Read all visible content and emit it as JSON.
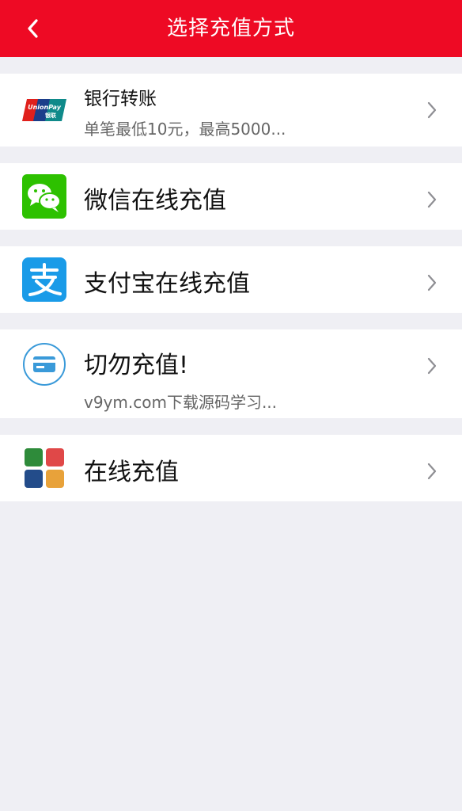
{
  "header": {
    "title": "选择充值方式",
    "back_icon": "chevron-left-icon"
  },
  "methods": [
    {
      "icon": "unionpay-icon",
      "title": "银行转账",
      "subtitle": "单笔最低10元，最高5000...",
      "chevron": "chevron-right-icon"
    },
    {
      "icon": "wechat-icon",
      "title": "微信在线充值",
      "chevron": "chevron-right-icon"
    },
    {
      "icon": "alipay-icon",
      "title": "支付宝在线充值",
      "chevron": "chevron-right-icon"
    },
    {
      "icon": "card-icon",
      "title": "切勿充值!",
      "subtitle": "v9ym.com下载源码学习...",
      "chevron": "chevron-right-icon"
    },
    {
      "icon": "grid-apps-icon",
      "title": "在线充值",
      "chevron": "chevron-right-icon"
    }
  ],
  "colors": {
    "header_bg": "#ee0a24",
    "page_bg": "#efeff4",
    "wechat_green": "#2dc100",
    "alipay_blue": "#1a9be8",
    "card_icon_blue": "#3a9ad9",
    "grid_green": "#2e8b3a",
    "grid_red": "#e04848",
    "grid_blue": "#234c8a",
    "grid_orange": "#e8a23a"
  }
}
